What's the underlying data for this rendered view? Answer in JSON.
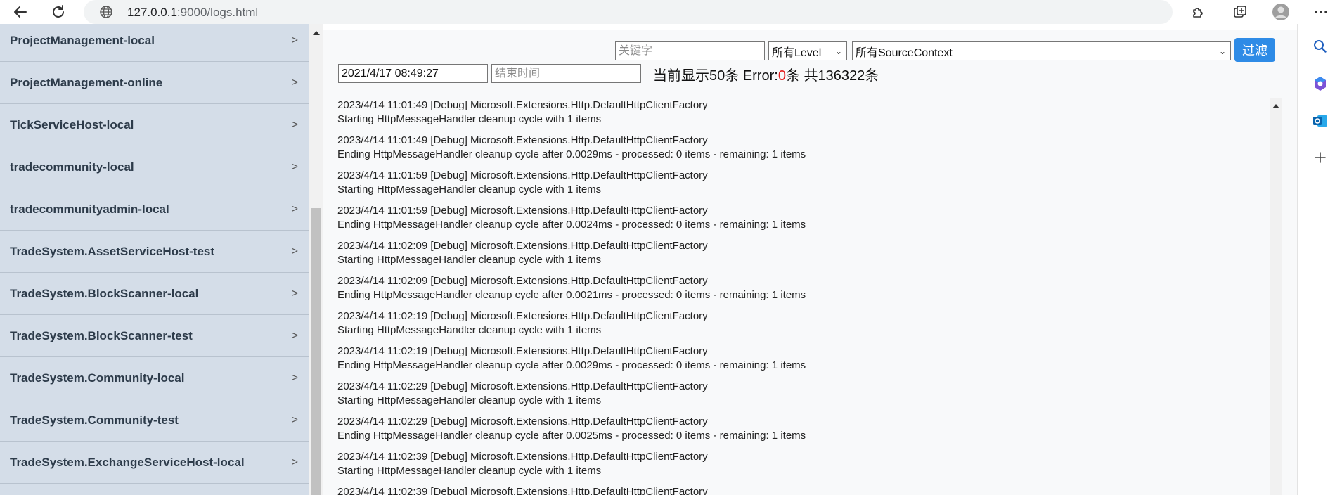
{
  "browser": {
    "url_host": "127.0.0.1",
    "url_rest": ":9000/logs.html"
  },
  "projects": [
    {
      "label": "ProjectManagement-local",
      "chevron": ">"
    },
    {
      "label": "ProjectManagement-online",
      "chevron": ">"
    },
    {
      "label": "TickServiceHost-local",
      "chevron": ">"
    },
    {
      "label": "tradecommunity-local",
      "chevron": ">"
    },
    {
      "label": "tradecommunityadmin-local",
      "chevron": ">"
    },
    {
      "label": "TradeSystem.AssetServiceHost-test",
      "chevron": ">"
    },
    {
      "label": "TradeSystem.BlockScanner-local",
      "chevron": ">"
    },
    {
      "label": "TradeSystem.BlockScanner-test",
      "chevron": ">"
    },
    {
      "label": "TradeSystem.Community-local",
      "chevron": ">"
    },
    {
      "label": "TradeSystem.Community-test",
      "chevron": ">"
    },
    {
      "label": "TradeSystem.ExchangeServiceHost-local",
      "chevron": ">"
    }
  ],
  "filters": {
    "keyword_placeholder": "关键字",
    "level_selected": "所有Level",
    "source_selected": "所有SourceContext",
    "filter_button": "过滤",
    "start_time_value": "2021/4/17 08:49:27",
    "end_time_placeholder": "结束时间"
  },
  "stats": {
    "prefix": "当前显示50条 Error:",
    "error_count": "0",
    "suffix": "条 共136322条"
  },
  "logs": [
    {
      "header": "2023/4/14 11:01:49 [Debug] Microsoft.Extensions.Http.DefaultHttpClientFactory",
      "message": "Starting HttpMessageHandler cleanup cycle with 1 items"
    },
    {
      "header": "2023/4/14 11:01:49 [Debug] Microsoft.Extensions.Http.DefaultHttpClientFactory",
      "message": "Ending HttpMessageHandler cleanup cycle after 0.0029ms - processed: 0 items - remaining: 1 items"
    },
    {
      "header": "2023/4/14 11:01:59 [Debug] Microsoft.Extensions.Http.DefaultHttpClientFactory",
      "message": "Starting HttpMessageHandler cleanup cycle with 1 items"
    },
    {
      "header": "2023/4/14 11:01:59 [Debug] Microsoft.Extensions.Http.DefaultHttpClientFactory",
      "message": "Ending HttpMessageHandler cleanup cycle after 0.0024ms - processed: 0 items - remaining: 1 items"
    },
    {
      "header": "2023/4/14 11:02:09 [Debug] Microsoft.Extensions.Http.DefaultHttpClientFactory",
      "message": "Starting HttpMessageHandler cleanup cycle with 1 items"
    },
    {
      "header": "2023/4/14 11:02:09 [Debug] Microsoft.Extensions.Http.DefaultHttpClientFactory",
      "message": "Ending HttpMessageHandler cleanup cycle after 0.0021ms - processed: 0 items - remaining: 1 items"
    },
    {
      "header": "2023/4/14 11:02:19 [Debug] Microsoft.Extensions.Http.DefaultHttpClientFactory",
      "message": "Starting HttpMessageHandler cleanup cycle with 1 items"
    },
    {
      "header": "2023/4/14 11:02:19 [Debug] Microsoft.Extensions.Http.DefaultHttpClientFactory",
      "message": "Ending HttpMessageHandler cleanup cycle after 0.0029ms - processed: 0 items - remaining: 1 items"
    },
    {
      "header": "2023/4/14 11:02:29 [Debug] Microsoft.Extensions.Http.DefaultHttpClientFactory",
      "message": "Starting HttpMessageHandler cleanup cycle with 1 items"
    },
    {
      "header": "2023/4/14 11:02:29 [Debug] Microsoft.Extensions.Http.DefaultHttpClientFactory",
      "message": "Ending HttpMessageHandler cleanup cycle after 0.0025ms - processed: 0 items - remaining: 1 items"
    },
    {
      "header": "2023/4/14 11:02:39 [Debug] Microsoft.Extensions.Http.DefaultHttpClientFactory",
      "message": "Starting HttpMessageHandler cleanup cycle with 1 items"
    },
    {
      "header": "2023/4/14 11:02:39 [Debug] Microsoft.Extensions.Http.DefaultHttpClientFactory",
      "message": ""
    }
  ]
}
